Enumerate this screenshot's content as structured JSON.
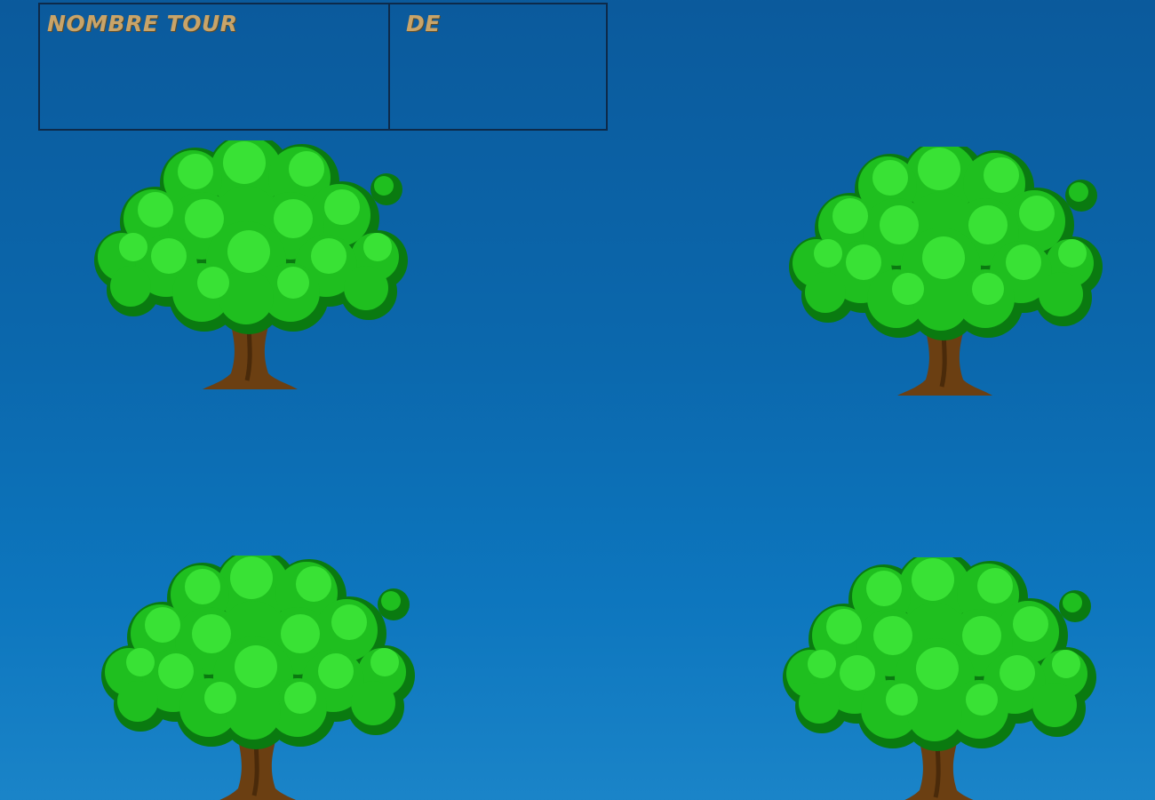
{
  "hud": {
    "turns_label": "Nombre tour",
    "turns_value": "",
    "dice_label": "De",
    "dice_value": ""
  },
  "trees": [
    {
      "id": "tree-top-left"
    },
    {
      "id": "tree-top-right"
    },
    {
      "id": "tree-bottom-left"
    },
    {
      "id": "tree-bottom-right"
    }
  ],
  "colors": {
    "sky_top": "#0b5a9c",
    "sky_bottom": "#1a84c8",
    "label": "#c8a469",
    "foliage": "#1fbf1f",
    "foliage_dark": "#0a7a10",
    "trunk": "#6b3f12"
  }
}
